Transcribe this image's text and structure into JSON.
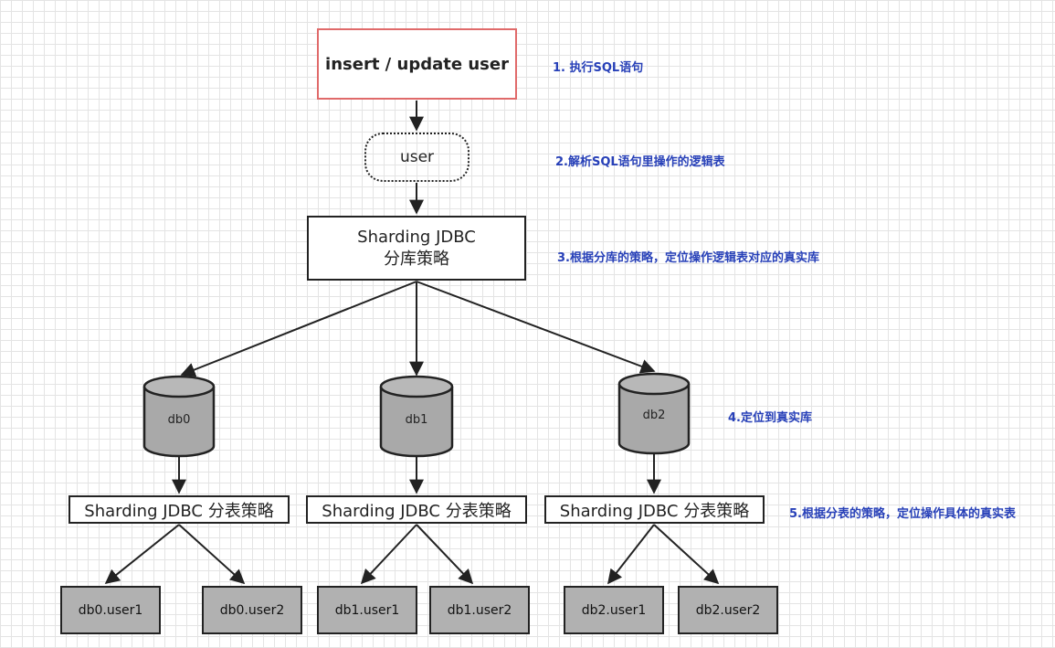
{
  "colors": {
    "note_text": "#2740b8",
    "sql_border": "#e06a6a",
    "db_fill": "#a9a9a9",
    "table_fill": "#b1b1b1"
  },
  "diagram": {
    "sql_box": "insert / update user",
    "logic_table": "user",
    "db_sharding": {
      "line1": "Sharding JDBC",
      "line2": "分库策略"
    },
    "databases": [
      "db0",
      "db1",
      "db2"
    ],
    "table_sharding": [
      "Sharding JDBC 分表策略",
      "Sharding JDBC 分表策略",
      "Sharding JDBC 分表策略"
    ],
    "tables": [
      [
        "db0.user1",
        "db0.user2"
      ],
      [
        "db1.user1",
        "db1.user2"
      ],
      [
        "db2.user1",
        "db2.user2"
      ]
    ]
  },
  "notes": [
    "1. 执行SQL语句",
    "2.解析SQL语句里操作的逻辑表",
    "3.根据分库的策略，定位操作逻辑表对应的真实库",
    "4.定位到真实库",
    "5.根据分表的策略，定位操作具体的真实表"
  ]
}
